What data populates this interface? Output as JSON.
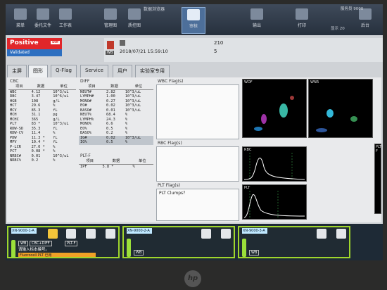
{
  "titlebar": {
    "title": "数据浏览器",
    "user": "服务员 9000",
    "clock": "15:59"
  },
  "toolbar": {
    "items": [
      "菜单",
      "委托文件",
      "工作表",
      "管理图",
      "质控图",
      "审核",
      "输出",
      "打印",
      "后台"
    ],
    "right_label": "退出",
    "right_sublabel": "显示 20"
  },
  "status": {
    "result": "Positive",
    "tag": "Diff",
    "validated": "Validated"
  },
  "sample": {
    "type": "WB",
    "datetime": "2018/07/21 15:59:10",
    "rack_no": "210",
    "seq": "5"
  },
  "tabs": [
    "主屏",
    "图形",
    "Q-Flag",
    "Service",
    "用户",
    "实验室专用"
  ],
  "active_tab": "图形",
  "cbc": {
    "title": "CBC",
    "headers": [
      "项目",
      "数据",
      "单位"
    ],
    "rows": [
      [
        "WBC",
        "4.12",
        "10^3/uL"
      ],
      [
        "RBC",
        "3.47",
        "10^6/uL"
      ],
      [
        "HGB",
        "108",
        "g/L"
      ],
      [
        "HCT",
        "29.6",
        "%"
      ],
      [
        "MCV",
        "85.3",
        "fL"
      ],
      [
        "MCH",
        "31.1",
        "pg"
      ],
      [
        "MCHC",
        "365",
        "g/L"
      ],
      [
        "PLT",
        "83 *",
        "10^3/uL"
      ],
      [
        "RDW-SD",
        "35.3",
        "fL"
      ],
      [
        "RDW-CV",
        "11.4",
        "%"
      ],
      [
        "PDW",
        "11.3 *",
        "fL"
      ],
      [
        "MPV",
        "10.4 *",
        "fL"
      ],
      [
        "P-LCR",
        "27.0 *",
        "%"
      ],
      [
        "PCT",
        "0.08 *",
        "%"
      ],
      [
        "NRBC#",
        "0.01",
        "10^3/uL"
      ],
      [
        "NRBC%",
        "0.2",
        "%"
      ]
    ]
  },
  "diff": {
    "title": "DIFF",
    "headers": [
      "项目",
      "数据",
      "单位"
    ],
    "rows": [
      [
        "NEUT#",
        "2.82",
        "10^3/uL"
      ],
      [
        "LYMPH#",
        "1.00",
        "10^3/uL"
      ],
      [
        "MONO#",
        "0.27",
        "10^3/uL"
      ],
      [
        "EO#",
        "0.02",
        "10^3/uL"
      ],
      [
        "BASO#",
        "0.01",
        "10^3/uL"
      ],
      [
        "NEUT%",
        "68.4",
        "%"
      ],
      [
        "LYMPH%",
        "24.3",
        "%"
      ],
      [
        "MONO%",
        "6.6",
        "%"
      ],
      [
        "EO%",
        "0.5",
        "%"
      ],
      [
        "BASO%",
        "0.2",
        "%"
      ],
      [
        "IG#",
        "0.02",
        "10^3/uL"
      ],
      [
        "IG%",
        "0.5",
        "%"
      ]
    ],
    "highlight_rows": [
      10,
      11
    ]
  },
  "pltf": {
    "title": "PLT-F",
    "headers": [
      "项目",
      "数据",
      "单位"
    ],
    "rows": [
      [
        "IPF",
        "5.8 *",
        "%"
      ]
    ]
  },
  "flags": {
    "wbc_title": "WBC Flag(s)",
    "rbc_title": "RBC Flag(s)",
    "plt_title": "PLT Flag(s)",
    "plt_text": "PLT Clumps?"
  },
  "plots": {
    "wdf": "WDF",
    "wnr": "WNR",
    "pltf": "PLT-F",
    "rbc": "RBC",
    "plt": "PLT"
  },
  "analyzers": [
    {
      "name": "XN-9000-1-A",
      "mode": "WB",
      "submode": "CBC+DIFF",
      "extra": "PLT-F",
      "prompt": "请输入标本编号。",
      "message": "Fluorocell PLT 已用"
    },
    {
      "name": "XN-9000-2-A",
      "mode": "WB"
    },
    {
      "name": "XN-9000-3-A",
      "mode": "WB"
    }
  ],
  "brand": "hp"
}
